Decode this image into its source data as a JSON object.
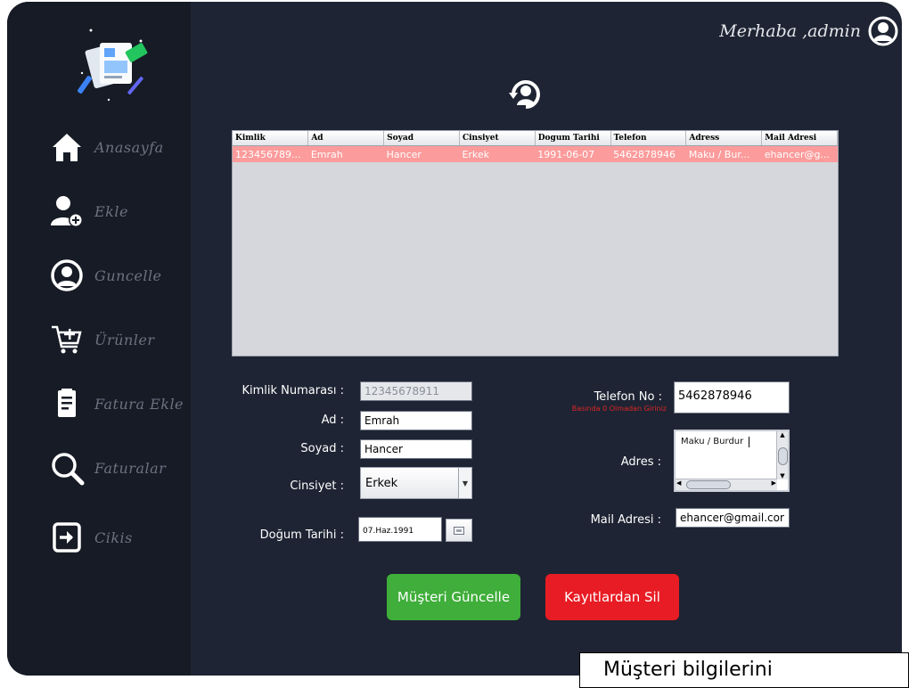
{
  "header": {
    "greeting": "Merhaba ,admin"
  },
  "sidebar": {
    "items": [
      {
        "label": "Anasayfa",
        "icon": "home-icon"
      },
      {
        "label": "Ekle",
        "icon": "add-user-icon"
      },
      {
        "label": "Guncelle",
        "icon": "update-user-icon"
      },
      {
        "label": "Ürünler",
        "icon": "cart-add-icon"
      },
      {
        "label": "Fatura Ekle",
        "icon": "invoice-icon"
      },
      {
        "label": "Faturalar",
        "icon": "search-icon"
      },
      {
        "label": "Cikis",
        "icon": "logout-icon"
      }
    ]
  },
  "table": {
    "columns": [
      "Kimlik",
      "Ad",
      "Soyad",
      "Cinsiyet",
      "Dogum Tarihi",
      "Telefon",
      "Adress",
      "Mail Adresi"
    ],
    "rows": [
      [
        "123456789...",
        "Emrah",
        "Hancer",
        "Erkek",
        "1991-06-07",
        "5462878946",
        "Maku / Bur...",
        "ehancer@g..."
      ]
    ]
  },
  "form": {
    "kimlik_label": "Kimlik Numarası :",
    "kimlik_value": "12345678911",
    "ad_label": "Ad :",
    "ad_value": "Emrah",
    "soyad_label": "Soyad :",
    "soyad_value": "Hancer",
    "cinsiyet_label": "Cinsiyet :",
    "cinsiyet_value": "Erkek",
    "dogum_label": "Doğum Tarihi :",
    "dogum_value": "07.Haz.1991",
    "telefon_label": "Telefon No :",
    "telefon_hint": "Basında 0 Olmadan Giriniz",
    "telefon_value": "5462878946",
    "adres_label": "Adres :",
    "adres_value": "Maku / Burdur",
    "mail_label": "Mail Adresi :",
    "mail_value": "ehancer@gmail.cor"
  },
  "buttons": {
    "update": "Müşteri Güncelle",
    "delete": "Kayıtlardan Sil"
  },
  "caption": "Müşteri bilgilerini",
  "colors": {
    "background": "#1e2433",
    "sidebar": "#161b25",
    "selected_row": "#fb9b9b",
    "update_button": "#3fae3a",
    "delete_button": "#e81c24"
  }
}
